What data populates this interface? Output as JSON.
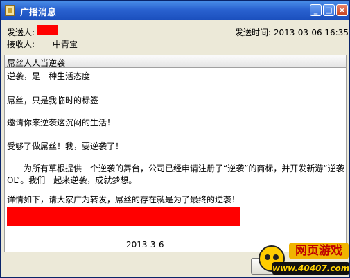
{
  "window": {
    "title": "广播消息",
    "minimize_label": "_",
    "maximize_label": "□",
    "close_label": "×"
  },
  "header": {
    "sender_label": "发送人:",
    "send_time": "发送时间: 2013-03-06  16:35",
    "recipient_label": "接收人:",
    "recipient_value": "中青宝"
  },
  "message": {
    "subject": "屌丝人人当逆袭",
    "lines": [
      "逆袭，是一种生活态度",
      "屌丝，只是我临时的标签",
      "邀请你来逆袭这沉闷的生活！",
      "受够了做屌丝！我，要逆袭了！",
      "　　为所有草根提供一个逆袭的舞台，公司已经申请注册了“逆袭”的商标，并开发新游“逆袭",
      "OL”。我们一起来逆袭，成就梦想。",
      "详情如下，请大家广为转发，屌丝的存在就是为了最终的逆袭！"
    ],
    "date": "2013-3-6"
  },
  "watermark": {
    "text": "网页游戏",
    "url": "www.40407.com"
  },
  "colors": {
    "redaction": "#ff0000",
    "titlebar": "#2a62d0"
  }
}
